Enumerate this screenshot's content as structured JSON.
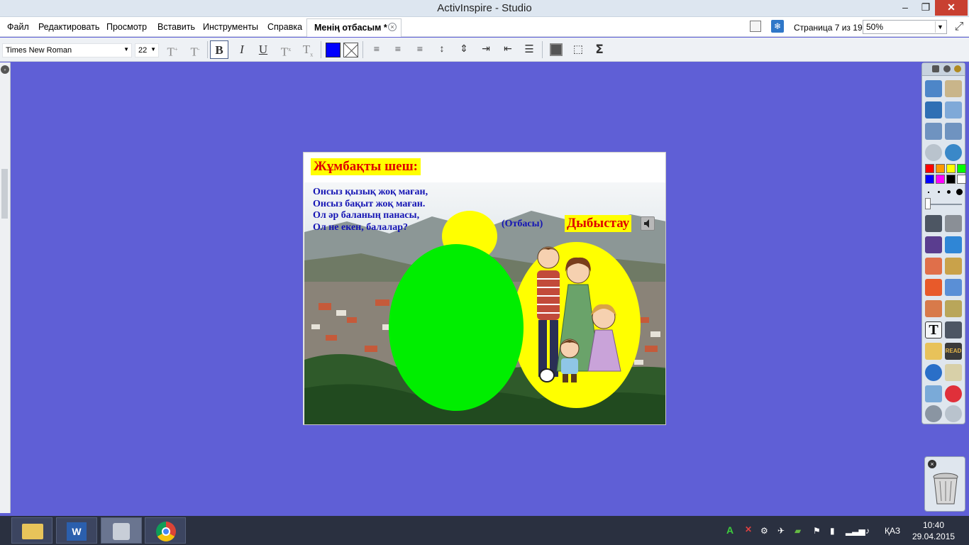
{
  "window": {
    "title": "ActivInspire - Studio",
    "minimize": "–",
    "restore": "❐",
    "close": "✕"
  },
  "menu": {
    "items": [
      "Файл",
      "Редактировать",
      "Просмотр",
      "Вставить",
      "Инструменты",
      "Справка"
    ],
    "doc_tab": "Менің отбасым *",
    "page_indicator": "Страница 7 из 19",
    "zoom": "50%"
  },
  "toolbar": {
    "font_family": "Times New Roman",
    "font_size": "22",
    "bold": "B",
    "italic": "I",
    "underline": "U",
    "superscript": "T",
    "subscript": "T",
    "grow_font": "T",
    "shrink_font": "T",
    "sum_symbol": "Σ",
    "text_color": "#0000ff"
  },
  "slide": {
    "title": "Жұмбақты шеш:",
    "riddle_lines": [
      "Онсыз қызық жоқ маған,",
      "Онсыз бақыт жоқ маған.",
      "Ол әр баланың панасы,",
      "Ол не екен, балалар?"
    ],
    "answer": "(Отбасы)",
    "sound_label": "Дыбыстау",
    "colors": {
      "title_bg": "#ffff00",
      "title_text": "#e00000",
      "riddle_text": "#1414b4",
      "green_ellipse": "#00ee00",
      "yellow_ellipse": "#ffff00"
    }
  },
  "palette": {
    "colors": [
      "#ff0000",
      "#ff9900",
      "#ffff00",
      "#00ff00",
      "#0000ff",
      "#ff00ff",
      "#000000",
      "#ffffff"
    ]
  },
  "taskbar": {
    "language": "ҚАЗ",
    "time": "10:40",
    "date": "29.04.2015"
  }
}
